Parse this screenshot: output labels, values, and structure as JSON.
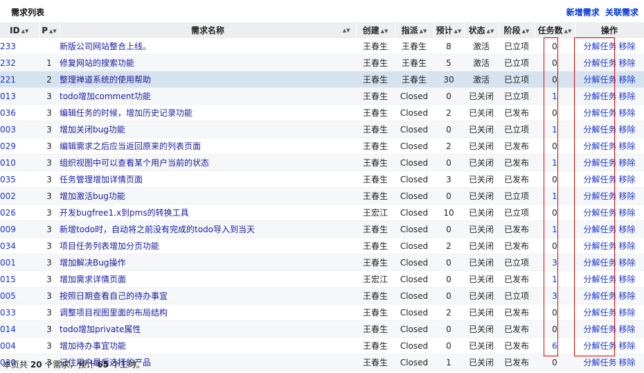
{
  "page_title": "需求列表",
  "actions": {
    "new_story": "新增需求",
    "link_story": "关联需求"
  },
  "columns": {
    "id": "ID",
    "pri": "P",
    "title": "需求名称",
    "creator": "创建",
    "assigned": "指派",
    "estimate": "预计",
    "status": "状态",
    "stage": "阶段",
    "tasks": "任务数",
    "ops": "操作"
  },
  "op_labels": {
    "split": "分解任务",
    "remove": "移除"
  },
  "rows": [
    {
      "id": "233",
      "pri": "",
      "title": "新版公司网站整合上线。",
      "creator": "王春生",
      "assigned": "王春生",
      "estimate": "8",
      "status": "激活",
      "stage": "已立项",
      "tasks": "0"
    },
    {
      "id": "232",
      "pri": "1",
      "title": "修复网站的搜索功能",
      "creator": "王春生",
      "assigned": "王春生",
      "estimate": "5",
      "status": "激活",
      "stage": "已立项",
      "tasks": "0"
    },
    {
      "id": "221",
      "pri": "2",
      "title": "整理禅道系统的使用帮助",
      "creator": "王春生",
      "assigned": "王春生",
      "estimate": "30",
      "status": "激活",
      "stage": "已立项",
      "tasks": "0"
    },
    {
      "id": "013",
      "pri": "3",
      "title": "todo增加comment功能",
      "creator": "王春生",
      "assigned": "Closed",
      "estimate": "0",
      "status": "已关闭",
      "stage": "已立项",
      "tasks": "1"
    },
    {
      "id": "036",
      "pri": "3",
      "title": "编辑任务的时候，增加历史记录功能",
      "creator": "王春生",
      "assigned": "Closed",
      "estimate": "2",
      "status": "已关闭",
      "stage": "已发布",
      "tasks": "0"
    },
    {
      "id": "003",
      "pri": "3",
      "title": "增加关闭bug功能",
      "creator": "王春生",
      "assigned": "Closed",
      "estimate": "0",
      "status": "已关闭",
      "stage": "已立项",
      "tasks": "1"
    },
    {
      "id": "029",
      "pri": "3",
      "title": "编辑需求之后应当返回原来的列表页面",
      "creator": "王春生",
      "assigned": "Closed",
      "estimate": "2",
      "status": "已关闭",
      "stage": "已发布",
      "tasks": "0"
    },
    {
      "id": "010",
      "pri": "3",
      "title": "组织视图中可以查看某个用户当前的状态",
      "creator": "王春生",
      "assigned": "Closed",
      "estimate": "0",
      "status": "已关闭",
      "stage": "已发布",
      "tasks": "1"
    },
    {
      "id": "035",
      "pri": "3",
      "title": "任务管理增加详情页面",
      "creator": "王春生",
      "assigned": "Closed",
      "estimate": "3",
      "status": "已关闭",
      "stage": "已发布",
      "tasks": "0"
    },
    {
      "id": "002",
      "pri": "3",
      "title": "增加激活bug功能",
      "creator": "王春生",
      "assigned": "Closed",
      "estimate": "0",
      "status": "已关闭",
      "stage": "已立项",
      "tasks": "1"
    },
    {
      "id": "026",
      "pri": "3",
      "title": "开发bugfree1.x到pms的转换工具",
      "creator": "王宏江",
      "assigned": "Closed",
      "estimate": "10",
      "status": "已关闭",
      "stage": "已立项",
      "tasks": "0"
    },
    {
      "id": "009",
      "pri": "3",
      "title": "新增todo时，自动将之前没有完成的todo导入到当天",
      "creator": "王春生",
      "assigned": "Closed",
      "estimate": "0",
      "status": "已关闭",
      "stage": "已发布",
      "tasks": "1"
    },
    {
      "id": "034",
      "pri": "3",
      "title": "项目任务列表增加分页功能",
      "creator": "王春生",
      "assigned": "Closed",
      "estimate": "2",
      "status": "已关闭",
      "stage": "已发布",
      "tasks": "0"
    },
    {
      "id": "001",
      "pri": "3",
      "title": "增加解决Bug操作",
      "creator": "王春生",
      "assigned": "Closed",
      "estimate": "0",
      "status": "已关闭",
      "stage": "已立项",
      "tasks": "3"
    },
    {
      "id": "015",
      "pri": "3",
      "title": "增加需求详情页面",
      "creator": "王宏江",
      "assigned": "Closed",
      "estimate": "0",
      "status": "已关闭",
      "stage": "已发布",
      "tasks": "1"
    },
    {
      "id": "005",
      "pri": "3",
      "title": "按照日期查看自己的待办事宜",
      "creator": "王春生",
      "assigned": "Closed",
      "estimate": "0",
      "status": "已关闭",
      "stage": "已立项",
      "tasks": "3"
    },
    {
      "id": "033",
      "pri": "3",
      "title": "调整项目视图里面的布局结构",
      "creator": "王春生",
      "assigned": "Closed",
      "estimate": "2",
      "status": "已关闭",
      "stage": "已发布",
      "tasks": "0"
    },
    {
      "id": "014",
      "pri": "3",
      "title": "todo增加private属性",
      "creator": "王春生",
      "assigned": "Closed",
      "estimate": "0",
      "status": "已关闭",
      "stage": "已发布",
      "tasks": "0"
    },
    {
      "id": "004",
      "pri": "3",
      "title": "增加待办事宜功能",
      "creator": "王春生",
      "assigned": "Closed",
      "estimate": "0",
      "status": "已关闭",
      "stage": "已发布",
      "tasks": "6"
    },
    {
      "id": "030",
      "pri": "3",
      "title": "记住用户最后选择的产品",
      "creator": "王春生",
      "assigned": "Closed",
      "estimate": "1",
      "status": "已关闭",
      "stage": "已发布",
      "tasks": "0"
    }
  ],
  "highlight_row": 2,
  "footer": {
    "prefix": "本页共",
    "count": "20",
    "mid": "个需求，预计",
    "hours": "65",
    "suffix": "个工时。"
  },
  "colors": {
    "link": "#1a33cc",
    "header_bg": "#eceef0",
    "highlight": "#d6e3ee",
    "annotation": "#dd0000"
  }
}
